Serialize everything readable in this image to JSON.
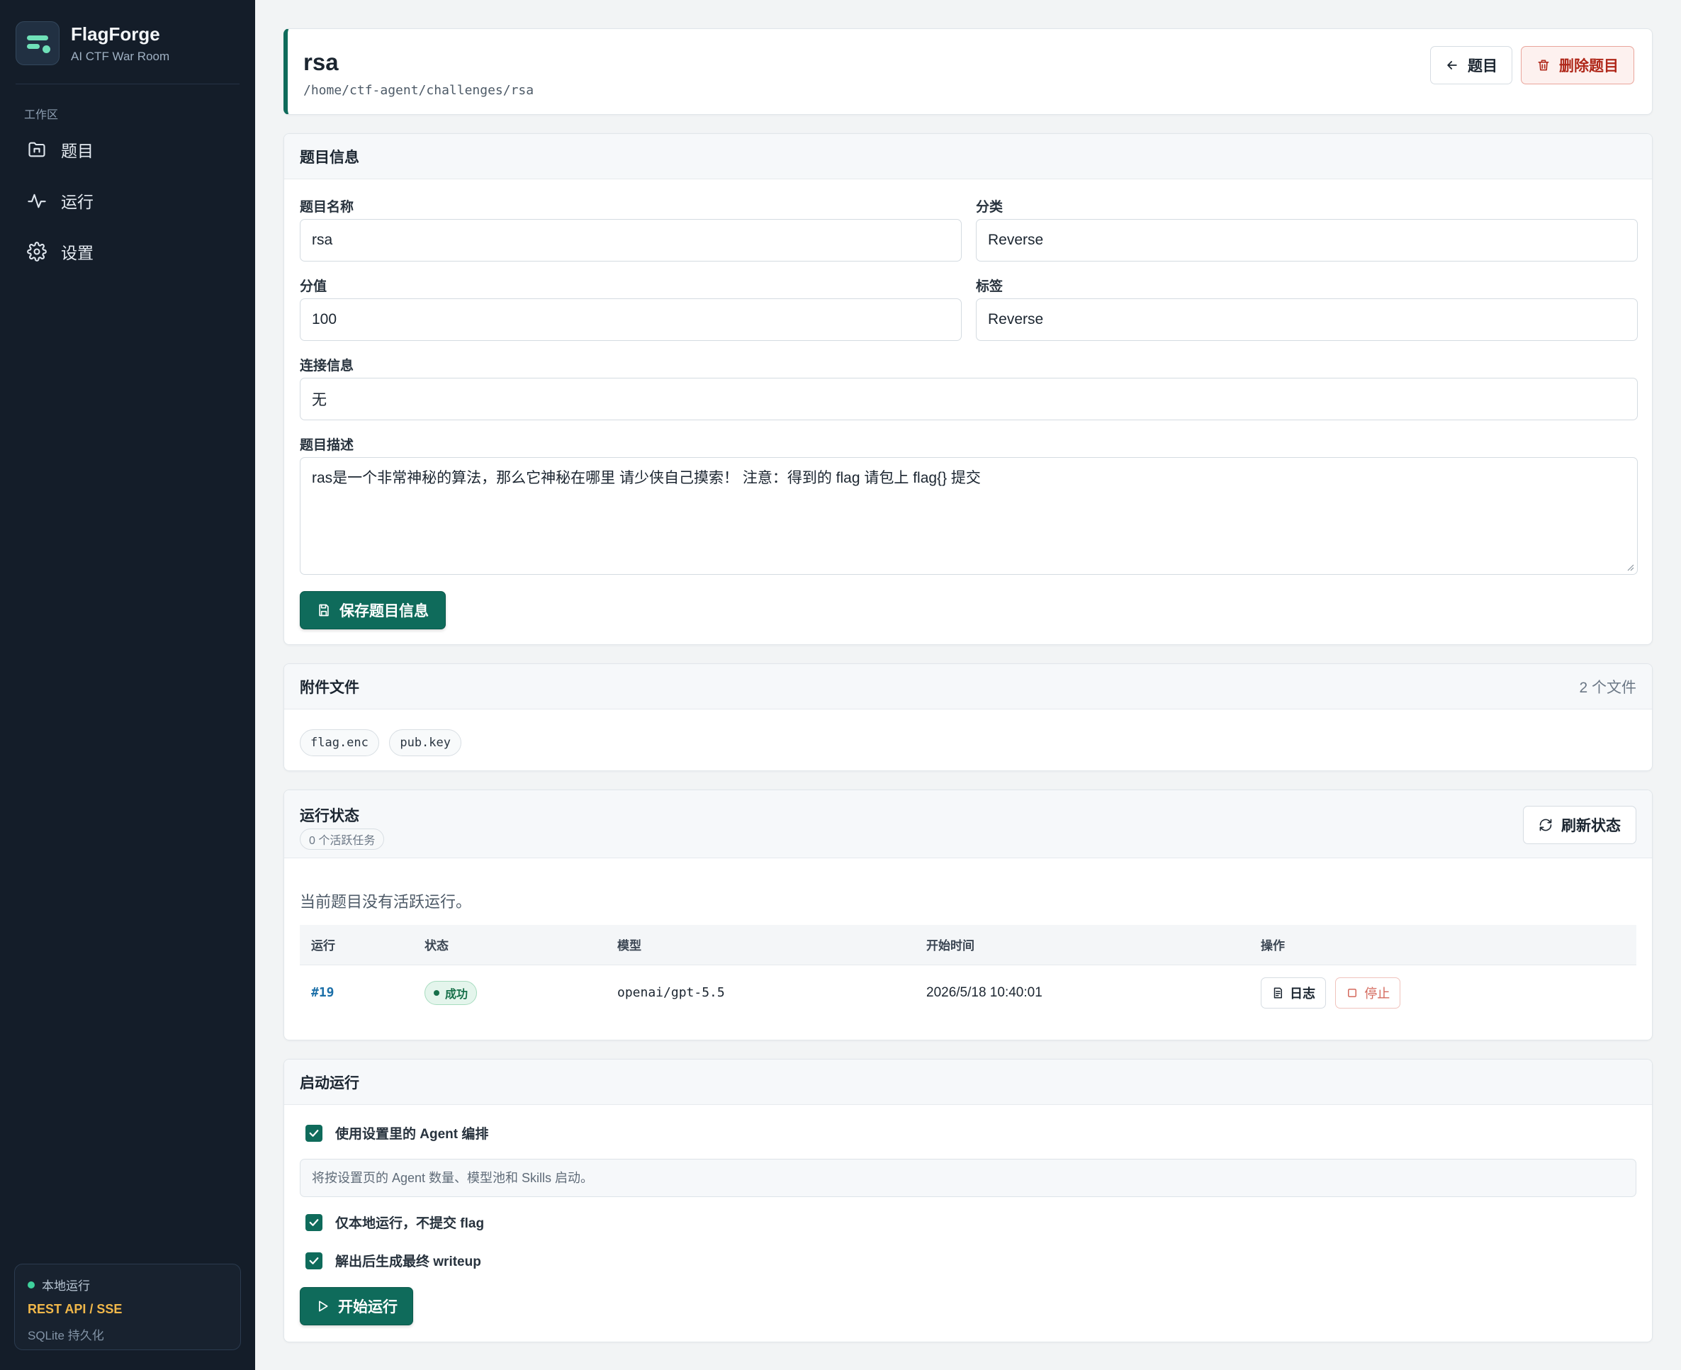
{
  "app": {
    "name": "FlagForge",
    "subtitle": "AI CTF War Room"
  },
  "sidebar": {
    "section": "工作区",
    "items": [
      {
        "label": "题目",
        "icon": "folder-icon"
      },
      {
        "label": "运行",
        "icon": "activity-icon"
      },
      {
        "label": "设置",
        "icon": "gear-icon"
      }
    ],
    "footer": {
      "status": "本地运行",
      "api": "REST API / SSE",
      "storage": "SQLite 持久化"
    }
  },
  "header": {
    "title": "rsa",
    "path": "/home/ctf-agent/challenges/rsa",
    "back_label": "题目",
    "delete_label": "删除题目"
  },
  "info": {
    "title": "题目信息",
    "name_label": "题目名称",
    "name_value": "rsa",
    "category_label": "分类",
    "category_value": "Reverse",
    "score_label": "分值",
    "score_value": "100",
    "tags_label": "标签",
    "tags_value": "Reverse",
    "connection_label": "连接信息",
    "connection_value": "无",
    "description_label": "题目描述",
    "description_value": "ras是一个非常神秘的算法，那么它神秘在哪里 请少侠自己摸索！ 注意：得到的 flag 请包上 flag{} 提交",
    "save_label": "保存题目信息"
  },
  "attachments": {
    "title": "附件文件",
    "count": "2 个文件",
    "files": [
      "flag.enc",
      "pub.key"
    ]
  },
  "run_status": {
    "title": "运行状态",
    "active_count": "0 个活跃任务",
    "refresh_label": "刷新状态",
    "empty_message": "当前题目没有活跃运行。",
    "columns": [
      "运行",
      "状态",
      "模型",
      "开始时间",
      "操作"
    ],
    "rows": [
      {
        "id": "#19",
        "status": "成功",
        "model": "openai/gpt-5.5",
        "started": "2026/5/18 10:40:01",
        "log_label": "日志",
        "stop_label": "停止"
      }
    ]
  },
  "launch": {
    "title": "启动运行",
    "use_agent_label": "使用设置里的 Agent 编排",
    "hint": "将按设置页的 Agent 数量、模型池和 Skills 启动。",
    "local_only_label": "仅本地运行，不提交 flag",
    "writeup_label": "解出后生成最终 writeup",
    "start_label": "开始运行"
  },
  "colors": {
    "accent": "#0f6b5b",
    "sidebar_bg": "#141d29",
    "danger": "#b0281a",
    "success": "#17704a",
    "warning_text": "#f1b84a"
  }
}
